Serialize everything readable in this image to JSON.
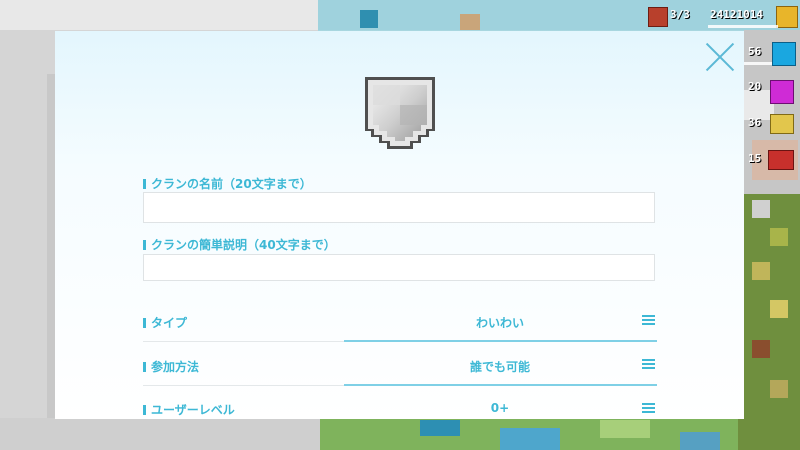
{
  "hud": {
    "count_text": "3/3",
    "currency_text": "24121014",
    "gem_blue_count": "56",
    "gem_purple_count": "20",
    "gold_count": "36",
    "ticket_count": "15"
  },
  "dialog": {
    "close_icon": "close-icon",
    "emblem_icon": "clan-shield-emblem-icon",
    "name_field": {
      "label": "クランの名前（20文字まで）",
      "value": "",
      "placeholder": ""
    },
    "desc_field": {
      "label": "クランの簡単説明（40文字まで）",
      "value": "",
      "placeholder": ""
    },
    "options": [
      {
        "label": "タイプ",
        "value": "わいわい"
      },
      {
        "label": "参加方法",
        "value": "誰でも可能"
      },
      {
        "label": "ユーザーレベル",
        "value": "0+"
      }
    ],
    "menu_icon": "hamburger-menu-icon"
  },
  "colors": {
    "accent": "#3db8d5",
    "close": "#5bb9d6",
    "input_border": "#dfe3e5"
  }
}
